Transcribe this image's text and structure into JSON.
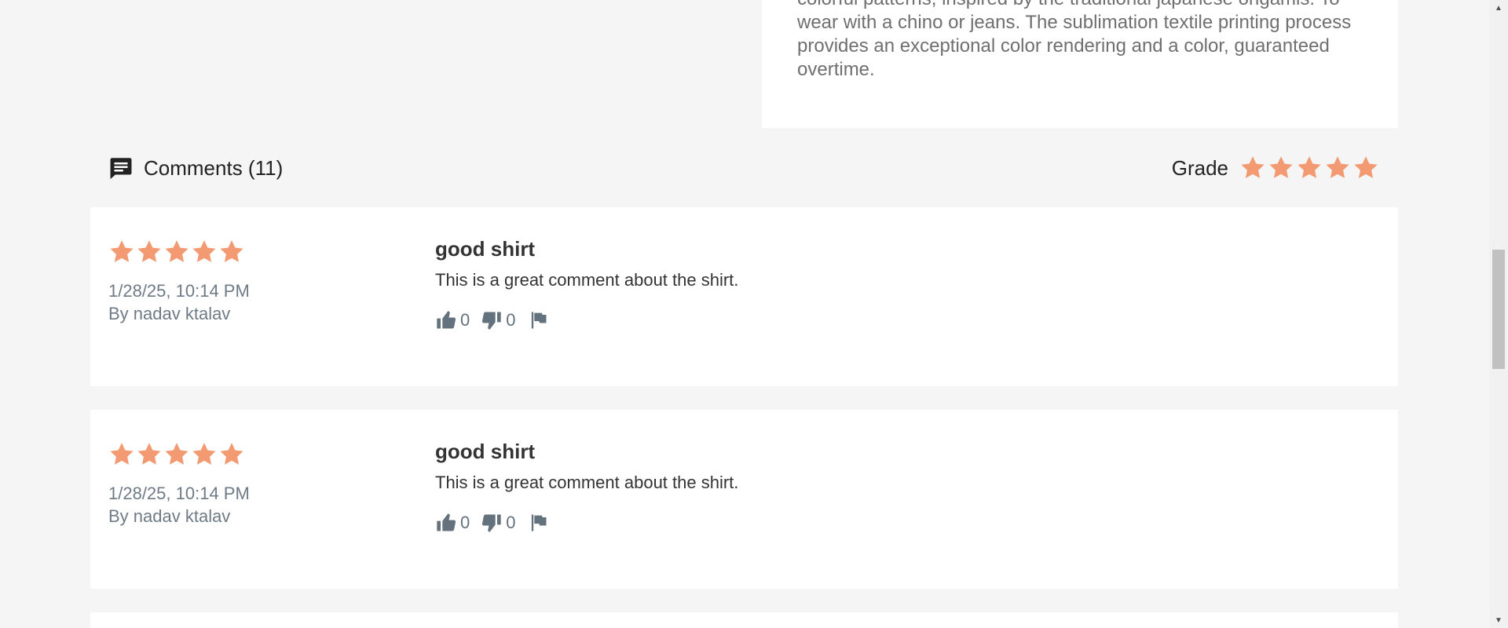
{
  "product": {
    "description": "colorful patterns, inspired by the traditional japanese origamis. To wear with a chino or jeans. The sublimation textile printing process provides an exceptional color rendering and a color, guaranteed overtime."
  },
  "comments_section": {
    "title": "Comments (11)",
    "icon": "comment-icon",
    "grade_label": "Grade",
    "grade_stars": 5
  },
  "comments": [
    {
      "stars": 5,
      "date": "1/28/25, 10:14 PM",
      "author": "By nadav ktalav",
      "title": "good shirt",
      "body": "This is a great comment about the shirt.",
      "likes": "0",
      "dislikes": "0"
    },
    {
      "stars": 5,
      "date": "1/28/25, 10:14 PM",
      "author": "By nadav ktalav",
      "title": "good shirt",
      "body": "This is a great comment about the shirt.",
      "likes": "0",
      "dislikes": "0"
    }
  ],
  "colors": {
    "star": "#f39a73",
    "muted": "#6e7b86",
    "background": "#f5f5f5"
  }
}
